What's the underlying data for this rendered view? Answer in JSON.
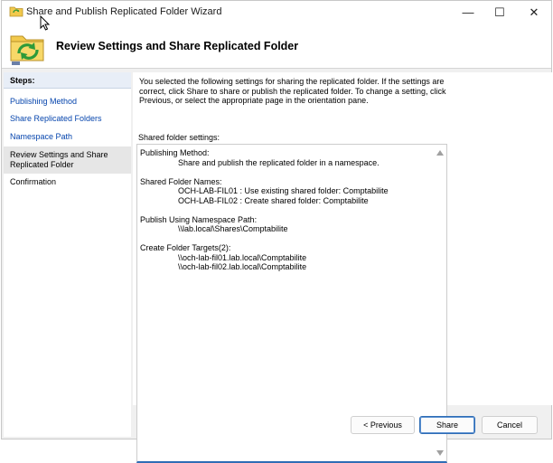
{
  "window": {
    "title": "Share and Publish Replicated Folder Wizard",
    "minimize_symbol": "—",
    "maximize_symbol": "☐",
    "close_symbol": "✕"
  },
  "header": {
    "title": "Review Settings and Share Replicated Folder"
  },
  "sidebar": {
    "heading": "Steps:",
    "items": [
      {
        "label": "Publishing Method",
        "state": "done"
      },
      {
        "label": "Share Replicated Folders",
        "state": "done"
      },
      {
        "label": "Namespace Path",
        "state": "done"
      },
      {
        "label": "Review Settings and Share Replicated Folder",
        "state": "current"
      },
      {
        "label": "Confirmation",
        "state": "pending"
      }
    ]
  },
  "main": {
    "intro": "You selected the following settings for sharing the replicated folder. If the settings are correct, click Share to share or publish the replicated folder. To change a setting, click Previous, or select the appropriate page in the orientation pane.",
    "settings_label": "Shared folder settings:",
    "settings": {
      "publishing_method_label": "Publishing Method:",
      "publishing_method_value": "Share and publish the replicated folder in a namespace.",
      "shared_folder_names_label": "Shared Folder Names:",
      "shared_folder_names": [
        "OCH-LAB-FIL01 : Use existing shared folder: Comptabilite",
        "OCH-LAB-FIL02 : Create shared folder: Comptabilite"
      ],
      "namespace_path_label": "Publish Using Namespace Path:",
      "namespace_path_value": "\\\\lab.local\\Shares\\Comptabilite",
      "folder_targets_label": "Create Folder Targets(2):",
      "folder_targets": [
        "\\\\och-lab-fil01.lab.local\\Comptabilite",
        "\\\\och-lab-fil02.lab.local\\Comptabilite"
      ]
    }
  },
  "buttons": {
    "previous": "< Previous",
    "share": "Share",
    "cancel": "Cancel"
  },
  "icons": {
    "app": "folder-sync-icon",
    "header": "folder-sync-large-icon",
    "scroll_up": "scroll-up-arrow-icon",
    "scroll_down": "scroll-down-arrow-icon"
  },
  "colors": {
    "link": "#0645ad",
    "accent": "#2f6db5",
    "steps_header_bg": "#e8eef7"
  }
}
